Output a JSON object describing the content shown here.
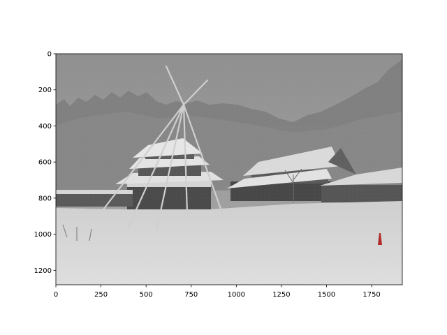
{
  "image": {
    "description_color_sky": "#8e8e8e",
    "description_color_snow": "#d9d9d9"
  },
  "axes": {
    "x_ticks": [
      "0",
      "250",
      "500",
      "750",
      "1000",
      "1250",
      "1500",
      "1750"
    ],
    "y_ticks": [
      "0",
      "200",
      "400",
      "600",
      "800",
      "1000",
      "1200"
    ],
    "x_range": [
      0,
      1920
    ],
    "y_range": [
      0,
      1280
    ]
  }
}
